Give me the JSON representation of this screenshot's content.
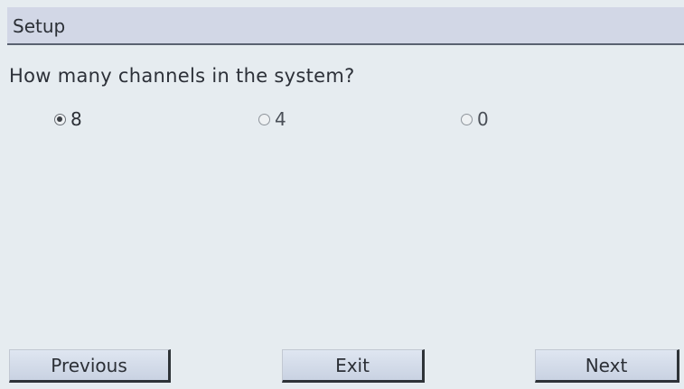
{
  "title": "Setup",
  "question": "How many channels in the system?",
  "options": [
    {
      "label": "8",
      "selected": true
    },
    {
      "label": "4",
      "selected": false
    },
    {
      "label": "0",
      "selected": false
    }
  ],
  "buttons": {
    "previous": "Previous",
    "exit": "Exit",
    "next": "Next"
  },
  "colors": {
    "background": "#e6ecf0",
    "title_bar": "#d2d7e6",
    "button_face": "#d3dbea"
  }
}
